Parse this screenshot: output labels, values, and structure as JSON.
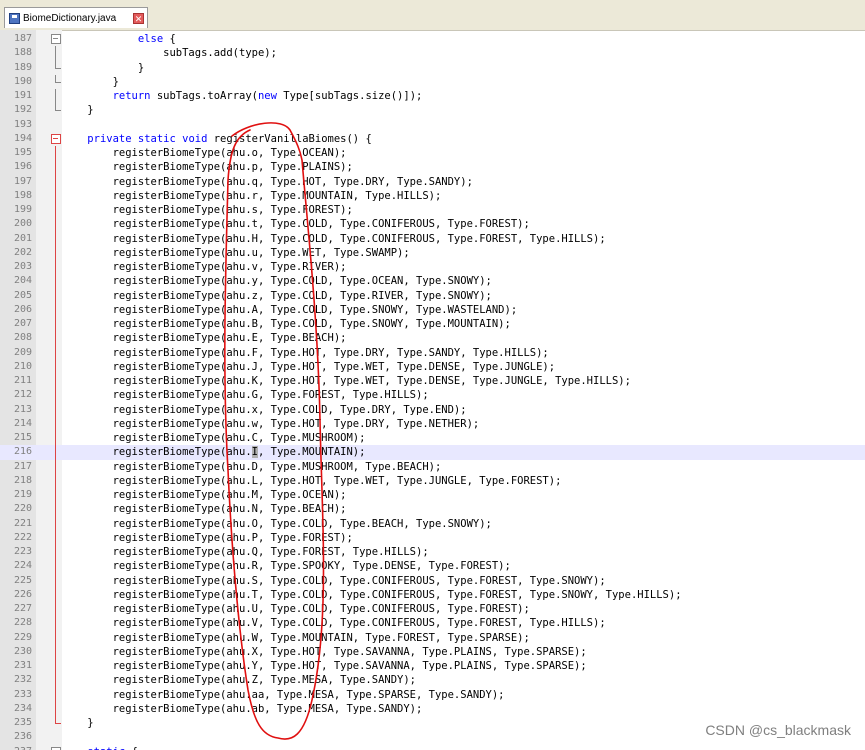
{
  "tab": {
    "title": "BiomeDictionary.java"
  },
  "current_line": 216,
  "lines": [
    {
      "n": "187",
      "fold": "vline-gray-box",
      "segs": [
        {
          "t": "            "
        },
        {
          "t": "else",
          "k": 1
        },
        {
          "t": " {"
        }
      ]
    },
    {
      "n": "188",
      "fold": "vline-gray",
      "segs": [
        {
          "t": "                subTags.add(type);"
        }
      ]
    },
    {
      "n": "189",
      "fold": "end-gray",
      "segs": [
        {
          "t": "            }"
        }
      ]
    },
    {
      "n": "190",
      "fold": "end-gray",
      "segs": [
        {
          "t": "        }"
        }
      ]
    },
    {
      "n": "191",
      "fold": "vline-gray",
      "segs": [
        {
          "t": "        "
        },
        {
          "t": "return",
          "k": 1
        },
        {
          "t": " subTags.toArray("
        },
        {
          "t": "new",
          "k": 1
        },
        {
          "t": " Type[subTags.size()]);"
        }
      ]
    },
    {
      "n": "192",
      "fold": "end-gray",
      "segs": [
        {
          "t": "    }"
        }
      ]
    },
    {
      "n": "193",
      "fold": "",
      "segs": [
        {
          "t": ""
        }
      ]
    },
    {
      "n": "194",
      "fold": "box",
      "segs": [
        {
          "t": "    "
        },
        {
          "t": "private static void",
          "k": 1
        },
        {
          "t": " registerVanillaBiomes() {"
        }
      ]
    },
    {
      "n": "195",
      "fold": "vline",
      "segs": [
        {
          "t": "        registerBiomeType(ahu.o, Type.OCEAN);"
        }
      ]
    },
    {
      "n": "196",
      "fold": "vline",
      "segs": [
        {
          "t": "        registerBiomeType(ahu.p, Type.PLAINS);"
        }
      ]
    },
    {
      "n": "197",
      "fold": "vline",
      "segs": [
        {
          "t": "        registerBiomeType(ahu.q, Type.HOT, Type.DRY, Type.SANDY);"
        }
      ]
    },
    {
      "n": "198",
      "fold": "vline",
      "segs": [
        {
          "t": "        registerBiomeType(ahu.r, Type.MOUNTAIN, Type.HILLS);"
        }
      ]
    },
    {
      "n": "199",
      "fold": "vline",
      "segs": [
        {
          "t": "        registerBiomeType(ahu.s, Type.FOREST);"
        }
      ]
    },
    {
      "n": "200",
      "fold": "vline",
      "segs": [
        {
          "t": "        registerBiomeType(ahu.t, Type.COLD, Type.CONIFEROUS, Type.FOREST);"
        }
      ]
    },
    {
      "n": "201",
      "fold": "vline",
      "segs": [
        {
          "t": "        registerBiomeType(ahu.H, Type.COLD, Type.CONIFEROUS, Type.FOREST, Type.HILLS);"
        }
      ]
    },
    {
      "n": "202",
      "fold": "vline",
      "segs": [
        {
          "t": "        registerBiomeType(ahu.u, Type.WET, Type.SWAMP);"
        }
      ]
    },
    {
      "n": "203",
      "fold": "vline",
      "segs": [
        {
          "t": "        registerBiomeType(ahu.v, Type.RIVER);"
        }
      ]
    },
    {
      "n": "204",
      "fold": "vline",
      "segs": [
        {
          "t": "        registerBiomeType(ahu.y, Type.COLD, Type.OCEAN, Type.SNOWY);"
        }
      ]
    },
    {
      "n": "205",
      "fold": "vline",
      "segs": [
        {
          "t": "        registerBiomeType(ahu.z, Type.COLD, Type.RIVER, Type.SNOWY);"
        }
      ]
    },
    {
      "n": "206",
      "fold": "vline",
      "segs": [
        {
          "t": "        registerBiomeType(ahu.A, Type.COLD, Type.SNOWY, Type.WASTELAND);"
        }
      ]
    },
    {
      "n": "207",
      "fold": "vline",
      "segs": [
        {
          "t": "        registerBiomeType(ahu.B, Type.COLD, Type.SNOWY, Type.MOUNTAIN);"
        }
      ]
    },
    {
      "n": "208",
      "fold": "vline",
      "segs": [
        {
          "t": "        registerBiomeType(ahu.E, Type.BEACH);"
        }
      ]
    },
    {
      "n": "209",
      "fold": "vline",
      "segs": [
        {
          "t": "        registerBiomeType(ahu.F, Type.HOT, Type.DRY, Type.SANDY, Type.HILLS);"
        }
      ]
    },
    {
      "n": "210",
      "fold": "vline",
      "segs": [
        {
          "t": "        registerBiomeType(ahu.J, Type.HOT, Type.WET, Type.DENSE, Type.JUNGLE);"
        }
      ]
    },
    {
      "n": "211",
      "fold": "vline",
      "segs": [
        {
          "t": "        registerBiomeType(ahu.K, Type.HOT, Type.WET, Type.DENSE, Type.JUNGLE, Type.HILLS);"
        }
      ]
    },
    {
      "n": "212",
      "fold": "vline",
      "segs": [
        {
          "t": "        registerBiomeType(ahu.G, Type.FOREST, Type.HILLS);"
        }
      ]
    },
    {
      "n": "213",
      "fold": "vline",
      "segs": [
        {
          "t": "        registerBiomeType(ahu.x, Type.COLD, Type.DRY, Type.END);"
        }
      ]
    },
    {
      "n": "214",
      "fold": "vline",
      "segs": [
        {
          "t": "        registerBiomeType(ahu.w, Type.HOT, Type.DRY, Type.NETHER);"
        }
      ]
    },
    {
      "n": "215",
      "fold": "vline",
      "segs": [
        {
          "t": "        registerBiomeType(ahu.C, Type.MUSHROOM);"
        }
      ]
    },
    {
      "n": "216",
      "fold": "vline",
      "segs": [
        {
          "t": "        registerBiomeType(ahu."
        },
        {
          "t": "I",
          "c": 1
        },
        {
          "t": ", Type.MOUNTAIN);"
        }
      ]
    },
    {
      "n": "217",
      "fold": "vline",
      "segs": [
        {
          "t": "        registerBiomeType(ahu.D, Type.MUSHROOM, Type.BEACH);"
        }
      ]
    },
    {
      "n": "218",
      "fold": "vline",
      "segs": [
        {
          "t": "        registerBiomeType(ahu.L, Type.HOT, Type.WET, Type.JUNGLE, Type.FOREST);"
        }
      ]
    },
    {
      "n": "219",
      "fold": "vline",
      "segs": [
        {
          "t": "        registerBiomeType(ahu.M, Type.OCEAN);"
        }
      ]
    },
    {
      "n": "220",
      "fold": "vline",
      "segs": [
        {
          "t": "        registerBiomeType(ahu.N, Type.BEACH);"
        }
      ]
    },
    {
      "n": "221",
      "fold": "vline",
      "segs": [
        {
          "t": "        registerBiomeType(ahu.O, Type.COLD, Type.BEACH, Type.SNOWY);"
        }
      ]
    },
    {
      "n": "222",
      "fold": "vline",
      "segs": [
        {
          "t": "        registerBiomeType(ahu.P, Type.FOREST);"
        }
      ]
    },
    {
      "n": "223",
      "fold": "vline",
      "segs": [
        {
          "t": "        registerBiomeType(ahu.Q, Type.FOREST, Type.HILLS);"
        }
      ]
    },
    {
      "n": "224",
      "fold": "vline",
      "segs": [
        {
          "t": "        registerBiomeType(ahu.R, Type.SPOOKY, Type.DENSE, Type.FOREST);"
        }
      ]
    },
    {
      "n": "225",
      "fold": "vline",
      "segs": [
        {
          "t": "        registerBiomeType(ahu.S, Type.COLD, Type.CONIFEROUS, Type.FOREST, Type.SNOWY);"
        }
      ]
    },
    {
      "n": "226",
      "fold": "vline",
      "segs": [
        {
          "t": "        registerBiomeType(ahu.T, Type.COLD, Type.CONIFEROUS, Type.FOREST, Type.SNOWY, Type.HILLS);"
        }
      ]
    },
    {
      "n": "227",
      "fold": "vline",
      "segs": [
        {
          "t": "        registerBiomeType(ahu.U, Type.COLD, Type.CONIFEROUS, Type.FOREST);"
        }
      ]
    },
    {
      "n": "228",
      "fold": "vline",
      "segs": [
        {
          "t": "        registerBiomeType(ahu.V, Type.COLD, Type.CONIFEROUS, Type.FOREST, Type.HILLS);"
        }
      ]
    },
    {
      "n": "229",
      "fold": "vline",
      "segs": [
        {
          "t": "        registerBiomeType(ahu.W, Type.MOUNTAIN, Type.FOREST, Type.SPARSE);"
        }
      ]
    },
    {
      "n": "230",
      "fold": "vline",
      "segs": [
        {
          "t": "        registerBiomeType(ahu.X, Type.HOT, Type.SAVANNA, Type.PLAINS, Type.SPARSE);"
        }
      ]
    },
    {
      "n": "231",
      "fold": "vline",
      "segs": [
        {
          "t": "        registerBiomeType(ahu.Y, Type.HOT, Type.SAVANNA, Type.PLAINS, Type.SPARSE);"
        }
      ]
    },
    {
      "n": "232",
      "fold": "vline",
      "segs": [
        {
          "t": "        registerBiomeType(ahu.Z, Type.MESA, Type.SANDY);"
        }
      ]
    },
    {
      "n": "233",
      "fold": "vline",
      "segs": [
        {
          "t": "        registerBiomeType(ahu.aa, Type.MESA, Type.SPARSE, Type.SANDY);"
        }
      ]
    },
    {
      "n": "234",
      "fold": "vline",
      "segs": [
        {
          "t": "        registerBiomeType(ahu.ab, Type.MESA, Type.SANDY);"
        }
      ]
    },
    {
      "n": "235",
      "fold": "end",
      "segs": [
        {
          "t": "    }"
        }
      ]
    },
    {
      "n": "236",
      "fold": "",
      "segs": [
        {
          "t": ""
        }
      ]
    },
    {
      "n": "237",
      "fold": "box-gray",
      "segs": [
        {
          "t": "    "
        },
        {
          "t": "static",
          "k": 1
        },
        {
          "t": " {"
        }
      ]
    }
  ],
  "watermark": "CSDN @cs_blackmask",
  "colors": {
    "keyword": "#0000ff",
    "annotation": "#e01010",
    "current_line": "#e8e8ff"
  }
}
